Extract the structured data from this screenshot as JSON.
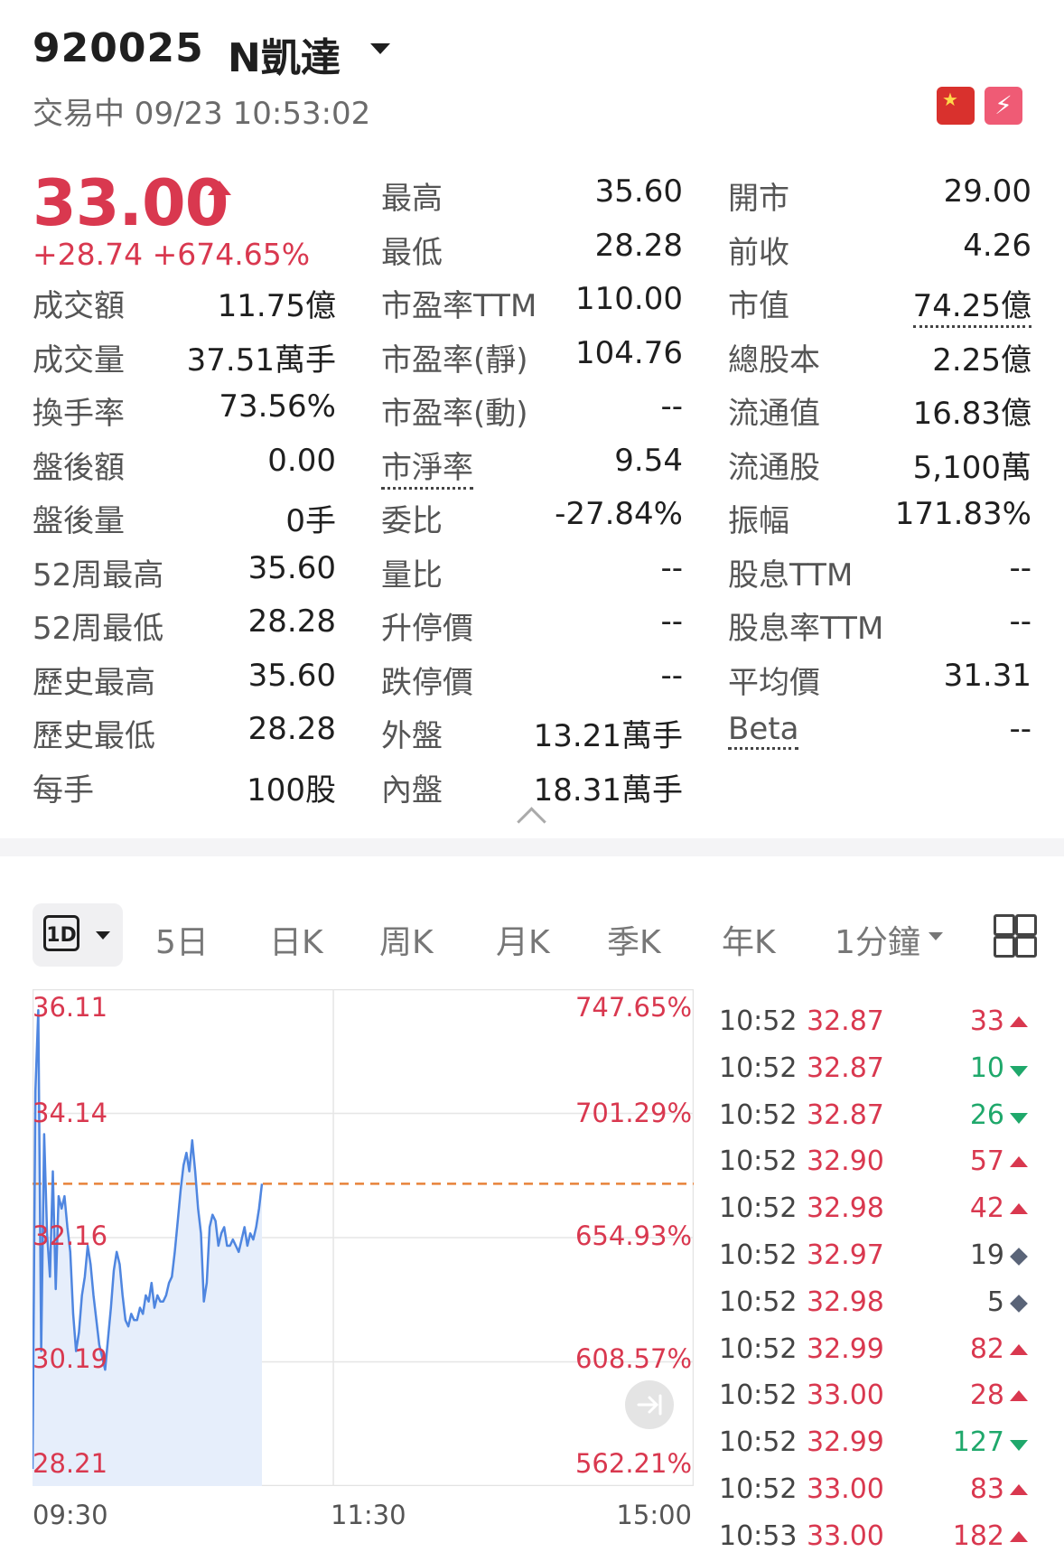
{
  "header": {
    "code": "920025",
    "name": "N凱達",
    "status": "交易中 09/23 10:53:02"
  },
  "quote": {
    "price": "33.00",
    "change": "+28.74 +674.65%"
  },
  "stats": {
    "col1": [
      {
        "label": "成交額",
        "value": "11.75億"
      },
      {
        "label": "成交量",
        "value": "37.51萬手"
      },
      {
        "label": "換手率",
        "value": "73.56%"
      },
      {
        "label": "盤後額",
        "value": "0.00"
      },
      {
        "label": "盤後量",
        "value": "0手"
      },
      {
        "label": "52周最高",
        "value": "35.60"
      },
      {
        "label": "52周最低",
        "value": "28.28"
      },
      {
        "label": "歷史最高",
        "value": "35.60"
      },
      {
        "label": "歷史最低",
        "value": "28.28"
      },
      {
        "label": "每手",
        "value": "100股"
      }
    ],
    "col2": [
      {
        "label": "最高",
        "value": "35.60"
      },
      {
        "label": "最低",
        "value": "28.28"
      },
      {
        "label": "市盈率TTM",
        "value": "110.00"
      },
      {
        "label": "市盈率(靜)",
        "value": "104.76"
      },
      {
        "label": "市盈率(動)",
        "value": "--"
      },
      {
        "label": "市淨率",
        "value": "9.54"
      },
      {
        "label": "委比",
        "value": "-27.84%"
      },
      {
        "label": "量比",
        "value": "--"
      },
      {
        "label": "升停價",
        "value": "--"
      },
      {
        "label": "跌停價",
        "value": "--"
      },
      {
        "label": "外盤",
        "value": "13.21萬手"
      },
      {
        "label": "內盤",
        "value": "18.31萬手"
      }
    ],
    "col3": [
      {
        "label": "開市",
        "value": "29.00"
      },
      {
        "label": "前收",
        "value": "4.26"
      },
      {
        "label": "市值",
        "value": "74.25億"
      },
      {
        "label": "總股本",
        "value": "2.25億"
      },
      {
        "label": "流通值",
        "value": "16.83億"
      },
      {
        "label": "流通股",
        "value": "5,100萬"
      },
      {
        "label": "振幅",
        "value": "171.83%"
      },
      {
        "label": "股息TTM",
        "value": "--"
      },
      {
        "label": "股息率TTM",
        "value": "--"
      },
      {
        "label": "平均價",
        "value": "31.31"
      },
      {
        "label": "Beta",
        "value": "--"
      }
    ]
  },
  "tabs": {
    "active": "1D",
    "items": [
      "5日",
      "日K",
      "周K",
      "月K",
      "季K",
      "年K",
      "1分鐘"
    ]
  },
  "chart_data": {
    "type": "line",
    "price_axis": [
      "36.11",
      "34.14",
      "32.16",
      "30.19",
      "28.21"
    ],
    "pct_axis": [
      "747.65%",
      "701.29%",
      "654.93%",
      "608.57%",
      "562.21%"
    ],
    "time_axis": [
      "09:30",
      "11:30",
      "15:00"
    ],
    "ylim": [
      28.21,
      36.11
    ],
    "reference_line": 33.0,
    "series": [
      {
        "values": [
          28.4,
          34.5,
          35.8,
          30.3,
          33.8,
          32.2,
          31.5,
          33.2,
          31.3,
          32.8,
          32.6,
          32.8,
          32.3,
          31.9,
          30.9,
          30.3,
          30.6,
          31.2,
          31.5,
          32.0,
          31.7,
          31.2,
          30.8,
          30.4,
          30.2,
          30.0,
          30.5,
          31.0,
          31.6,
          31.9,
          31.7,
          31.2,
          30.8,
          30.7,
          30.9,
          30.8,
          30.8,
          31.0,
          30.9,
          31.2,
          31.1,
          31.4,
          31.0,
          31.2,
          31.1,
          31.1,
          31.2,
          31.4,
          31.5,
          31.9,
          32.4,
          32.9,
          33.3,
          33.5,
          33.2,
          33.7,
          33.2,
          32.6,
          32.2,
          31.1,
          31.4,
          32.3,
          32.5,
          32.4,
          32.0,
          32.2,
          32.3,
          32.0,
          32.0,
          32.1,
          32.0,
          31.9,
          32.1,
          32.3,
          32.0,
          32.2,
          32.1,
          32.3,
          32.6,
          33.0
        ]
      }
    ]
  },
  "ticks": [
    {
      "time": "10:52",
      "price": "32.87",
      "vol": "33",
      "dir": "up"
    },
    {
      "time": "10:52",
      "price": "32.87",
      "vol": "10",
      "dir": "down"
    },
    {
      "time": "10:52",
      "price": "32.87",
      "vol": "26",
      "dir": "down"
    },
    {
      "time": "10:52",
      "price": "32.90",
      "vol": "57",
      "dir": "up"
    },
    {
      "time": "10:52",
      "price": "32.98",
      "vol": "42",
      "dir": "up"
    },
    {
      "time": "10:52",
      "price": "32.97",
      "vol": "19",
      "dir": "neutral"
    },
    {
      "time": "10:52",
      "price": "32.98",
      "vol": "5",
      "dir": "neutral"
    },
    {
      "time": "10:52",
      "price": "32.99",
      "vol": "82",
      "dir": "up"
    },
    {
      "time": "10:52",
      "price": "33.00",
      "vol": "28",
      "dir": "up"
    },
    {
      "time": "10:52",
      "price": "32.99",
      "vol": "127",
      "dir": "down"
    },
    {
      "time": "10:52",
      "price": "33.00",
      "vol": "83",
      "dir": "up"
    },
    {
      "time": "10:53",
      "price": "33.00",
      "vol": "182",
      "dir": "up"
    }
  ],
  "colors": {
    "up": "#d9384f",
    "down": "#1fa86b",
    "neutral": "#5a6478",
    "line": "#4f86e0",
    "fill": "#e6eefb",
    "reference": "#e8823a"
  },
  "icons": {
    "market_flag": "china-flag-icon",
    "flash": "flash-icon"
  }
}
